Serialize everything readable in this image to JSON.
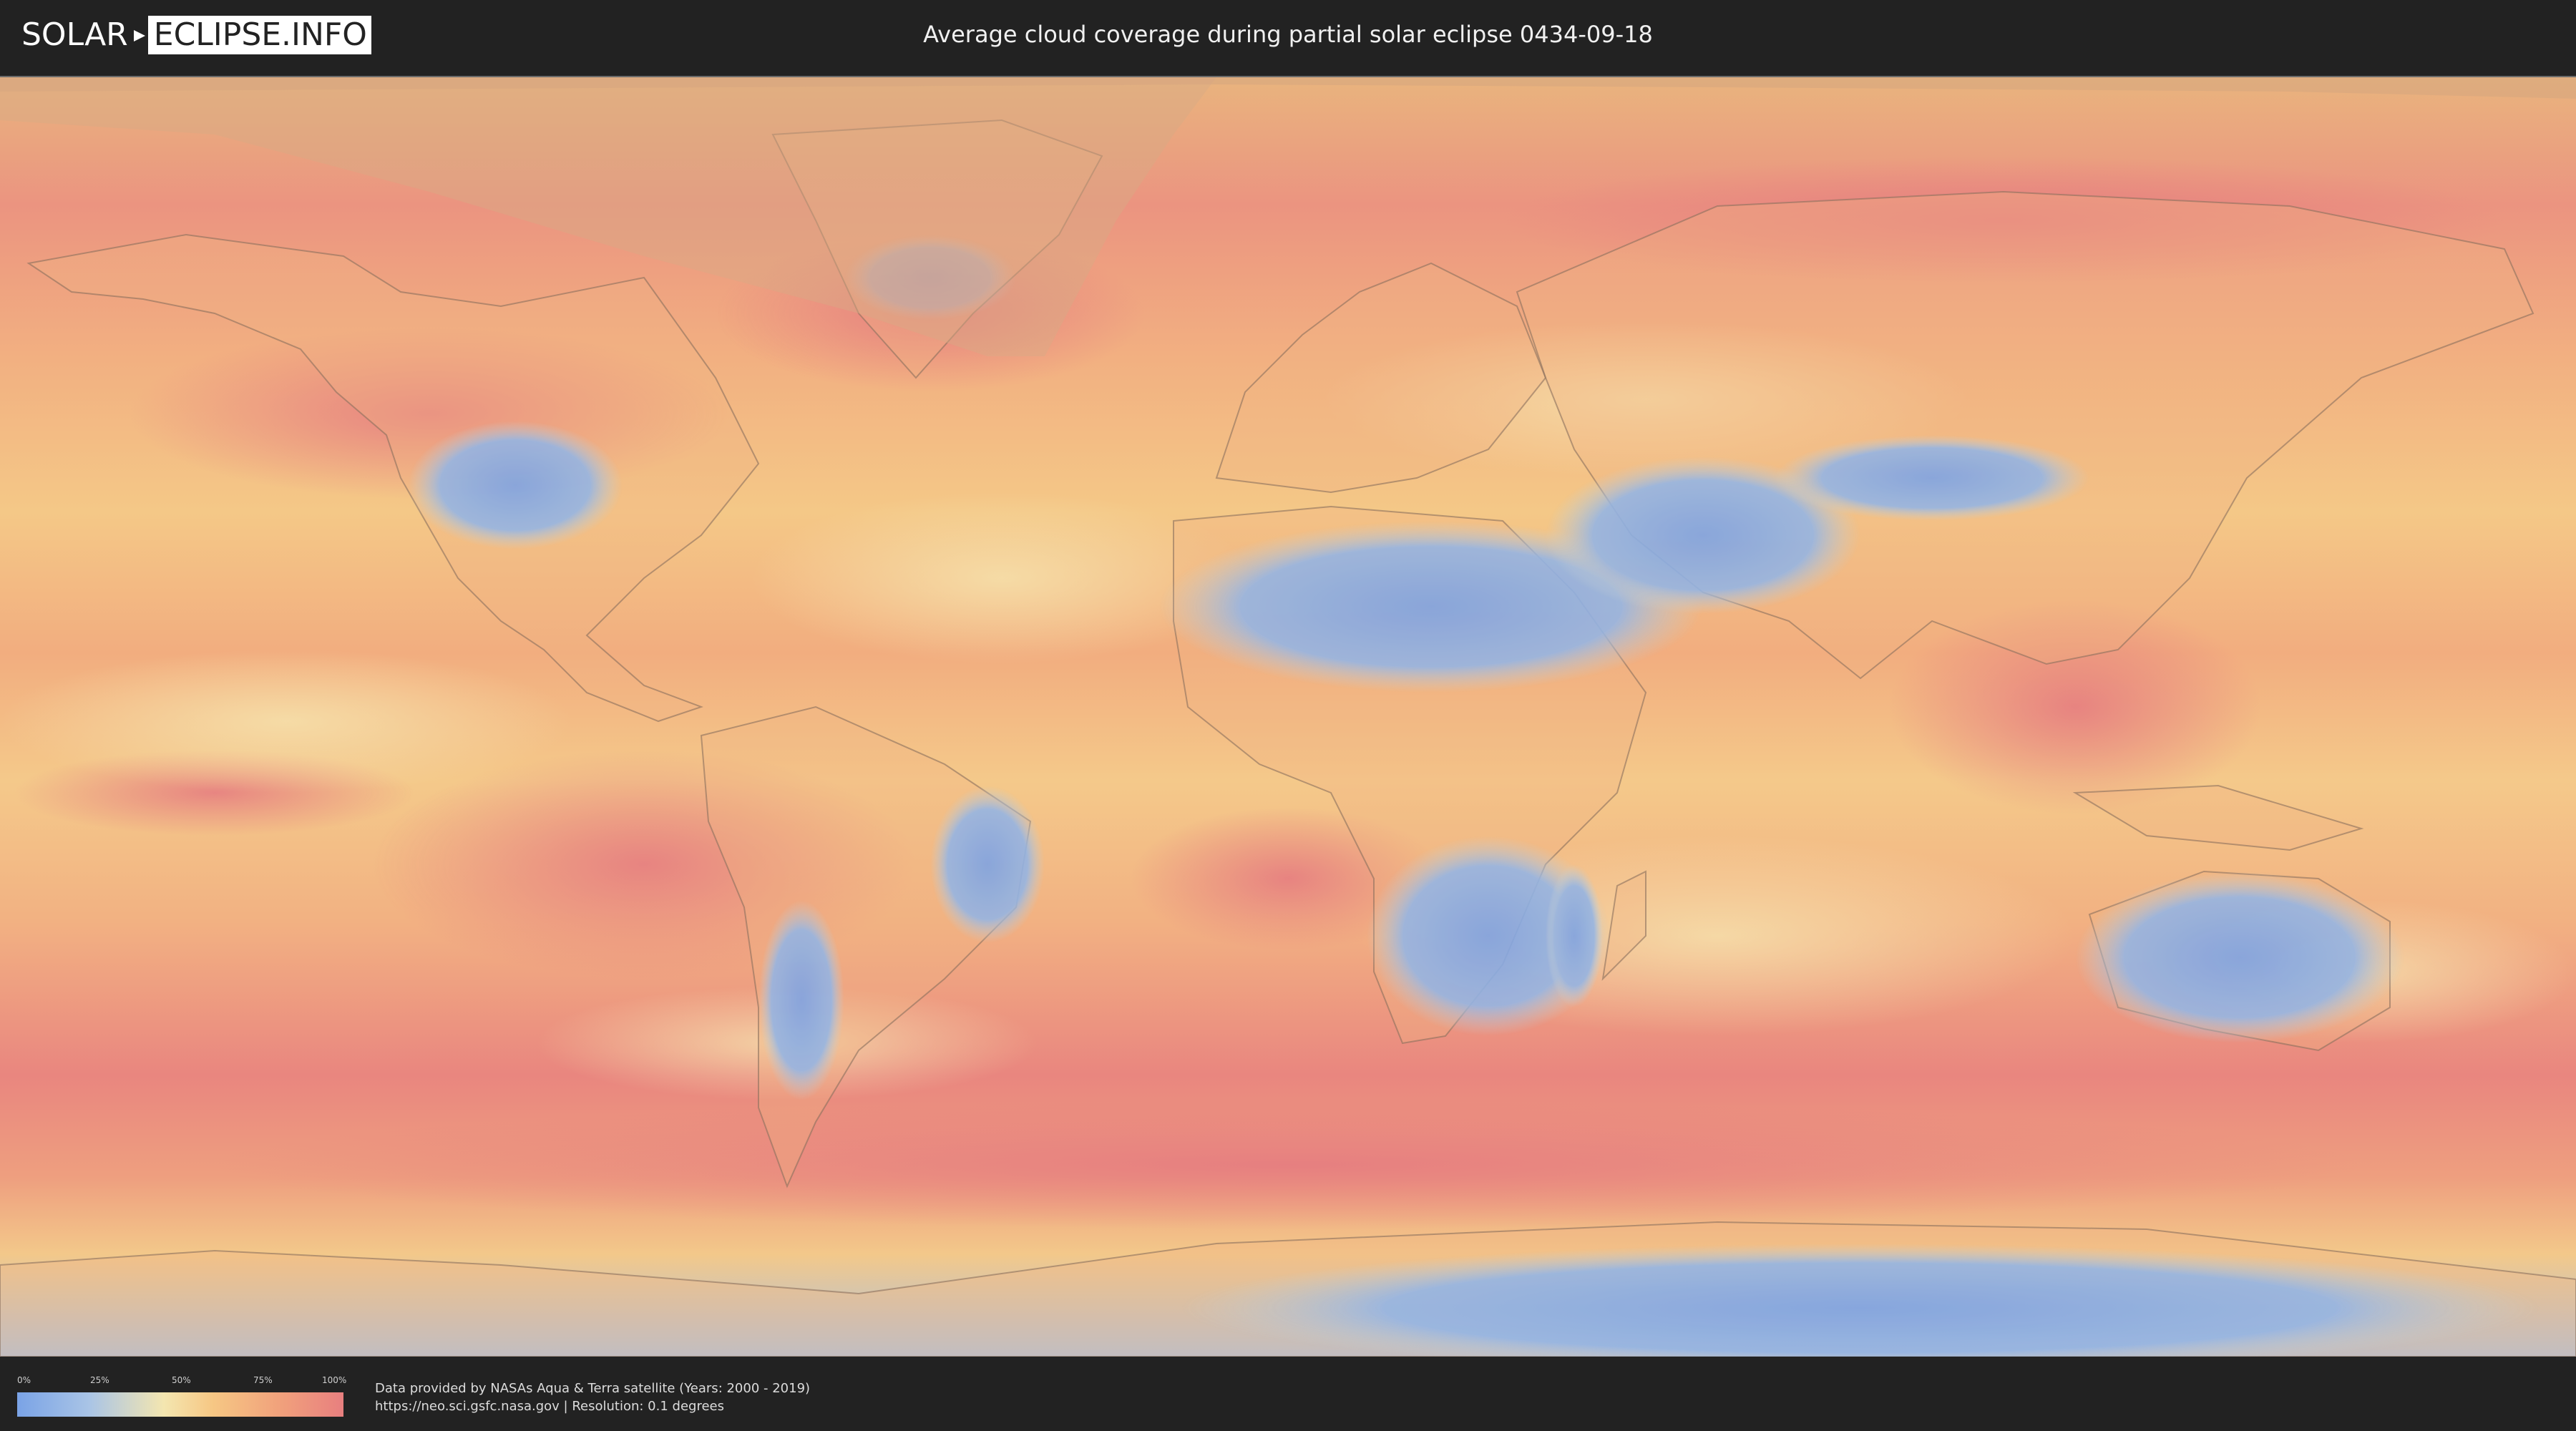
{
  "header": {
    "logo_left": "SOLAR",
    "logo_right": "ECLIPSE.INFO",
    "title": "Average cloud coverage during partial solar eclipse 0434-09-18"
  },
  "legend": {
    "ticks": [
      "0%",
      "25%",
      "50%",
      "75%",
      "100%"
    ],
    "tick_values": [
      0,
      25,
      50,
      75,
      100
    ],
    "colors": [
      "#7aa3e6",
      "#f4e6b0",
      "#f6c784",
      "#e87f7f"
    ]
  },
  "credits": {
    "line1": "Data provided by NASAs Aqua & Terra satellite (Years: 2000 - 2019)",
    "line2": "https://neo.sci.gsfc.nasa.gov | Resolution: 0.1 degrees"
  },
  "map": {
    "ocean_color": "#eea27d",
    "high_cloud_color": "#e57f80",
    "mid_cloud_color": "#f5c68a",
    "low_cloud_color": "#f3e6b5",
    "clear_color": "#7fa6e3",
    "border_color": "#8a6f5e",
    "shadow_color": "#d3a985"
  }
}
